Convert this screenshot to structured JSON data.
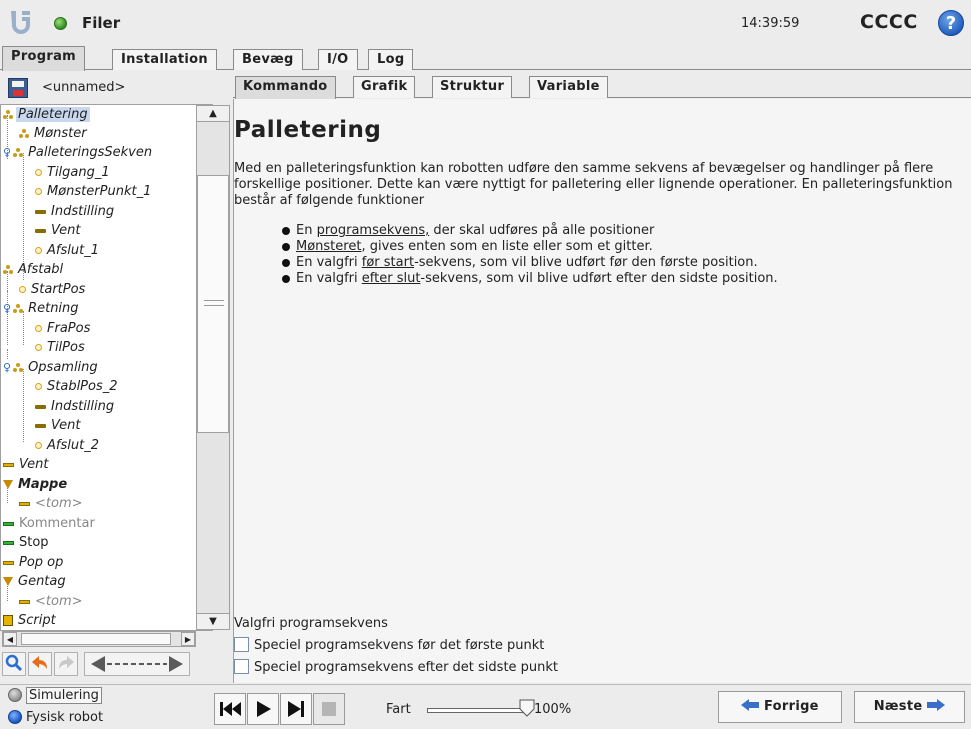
{
  "header": {
    "app_title": "Filer",
    "clock": "14:39:59",
    "robot_name": "CCCC",
    "help_glyph": "?",
    "status_color": "#2f8f1d"
  },
  "main_tabs": [
    {
      "label": "Program",
      "active": true
    },
    {
      "label": "Installation",
      "active": false
    },
    {
      "label": "Bevæg",
      "active": false
    },
    {
      "label": "I/O",
      "active": false
    },
    {
      "label": "Log",
      "active": false
    }
  ],
  "file": {
    "name": "<unnamed>"
  },
  "tree": [
    {
      "label": "Palletering",
      "icon": "group-icon",
      "selected": true
    },
    {
      "label": "Mønster",
      "icon": "group-icon"
    },
    {
      "label": "PalleteringsSekven",
      "icon": "group-icon"
    },
    {
      "label": "Tilgang_1",
      "icon": "waypoint-icon"
    },
    {
      "label": "MønsterPunkt_1",
      "icon": "waypoint-icon"
    },
    {
      "label": "Indstilling",
      "icon": "set-icon"
    },
    {
      "label": "Vent",
      "icon": "wait-icon"
    },
    {
      "label": "Afslut_1",
      "icon": "waypoint-icon"
    },
    {
      "label": "Afstabl",
      "icon": "group-icon"
    },
    {
      "label": "StartPos",
      "icon": "waypoint-icon"
    },
    {
      "label": "Retning",
      "icon": "group-icon"
    },
    {
      "label": "FraPos",
      "icon": "waypoint-icon"
    },
    {
      "label": "TilPos",
      "icon": "waypoint-icon"
    },
    {
      "label": "Opsamling",
      "icon": "group-icon"
    },
    {
      "label": "StablPos_2",
      "icon": "waypoint-icon"
    },
    {
      "label": "Indstilling",
      "icon": "set-icon"
    },
    {
      "label": "Vent",
      "icon": "wait-icon"
    },
    {
      "label": "Afslut_2",
      "icon": "waypoint-icon"
    },
    {
      "label": "Vent",
      "icon": "wait-icon"
    },
    {
      "label": "Mappe",
      "icon": "folder-icon"
    },
    {
      "label": "<tom>",
      "icon": "empty-icon"
    },
    {
      "label": "Kommentar",
      "icon": "comment-icon"
    },
    {
      "label": "Stop",
      "icon": "stop-icon"
    },
    {
      "label": "Pop op",
      "icon": "popup-icon"
    },
    {
      "label": "Gentag",
      "icon": "loop-icon"
    },
    {
      "label": "<tom>",
      "icon": "empty-icon"
    },
    {
      "label": "Script",
      "icon": "script-icon"
    }
  ],
  "sub_tabs": [
    {
      "label": "Kommando",
      "active": true
    },
    {
      "label": "Grafik",
      "active": false
    },
    {
      "label": "Struktur",
      "active": false
    },
    {
      "label": "Variable",
      "active": false
    }
  ],
  "content": {
    "title": "Palletering",
    "description": "Med en palleteringsfunktion kan robotten udføre den samme sekvens af bevægelser og handlinger på flere forskellige positioner. Dette kan være nyttigt for palletering eller lignende operationer. En palleteringsfunktion består af følgende funktioner",
    "bullets": [
      {
        "pre": "En ",
        "link": "programsekvens,",
        "post": " der skal udføres på alle positioner"
      },
      {
        "pre": "",
        "link": "Mønsteret",
        "post": ", gives enten som en liste eller som et gitter."
      },
      {
        "pre": "En valgfri ",
        "link": "før start",
        "post": "-sekvens, som vil blive udført før den første position."
      },
      {
        "pre": "En valgfri ",
        "link": "efter slut",
        "post": "-sekvens, som vil blive udført efter den sidste position."
      }
    ],
    "optional_title": "Valgfri programsekvens",
    "checkbox_before": {
      "label": "Speciel programsekvens før det første punkt",
      "checked": false
    },
    "checkbox_after": {
      "label": "Speciel programsekvens efter det sidste punkt",
      "checked": false
    }
  },
  "bottom": {
    "mode_sim": "Simulering",
    "mode_real": "Fysisk robot",
    "speed_label": "Fart",
    "speed_value": "100%",
    "speed_fraction": 1.0,
    "prev_label": "Forrige",
    "next_label": "Næste"
  },
  "colors": {
    "accent_blue": "#3a6fc9",
    "selection": "#c9d8ee"
  }
}
